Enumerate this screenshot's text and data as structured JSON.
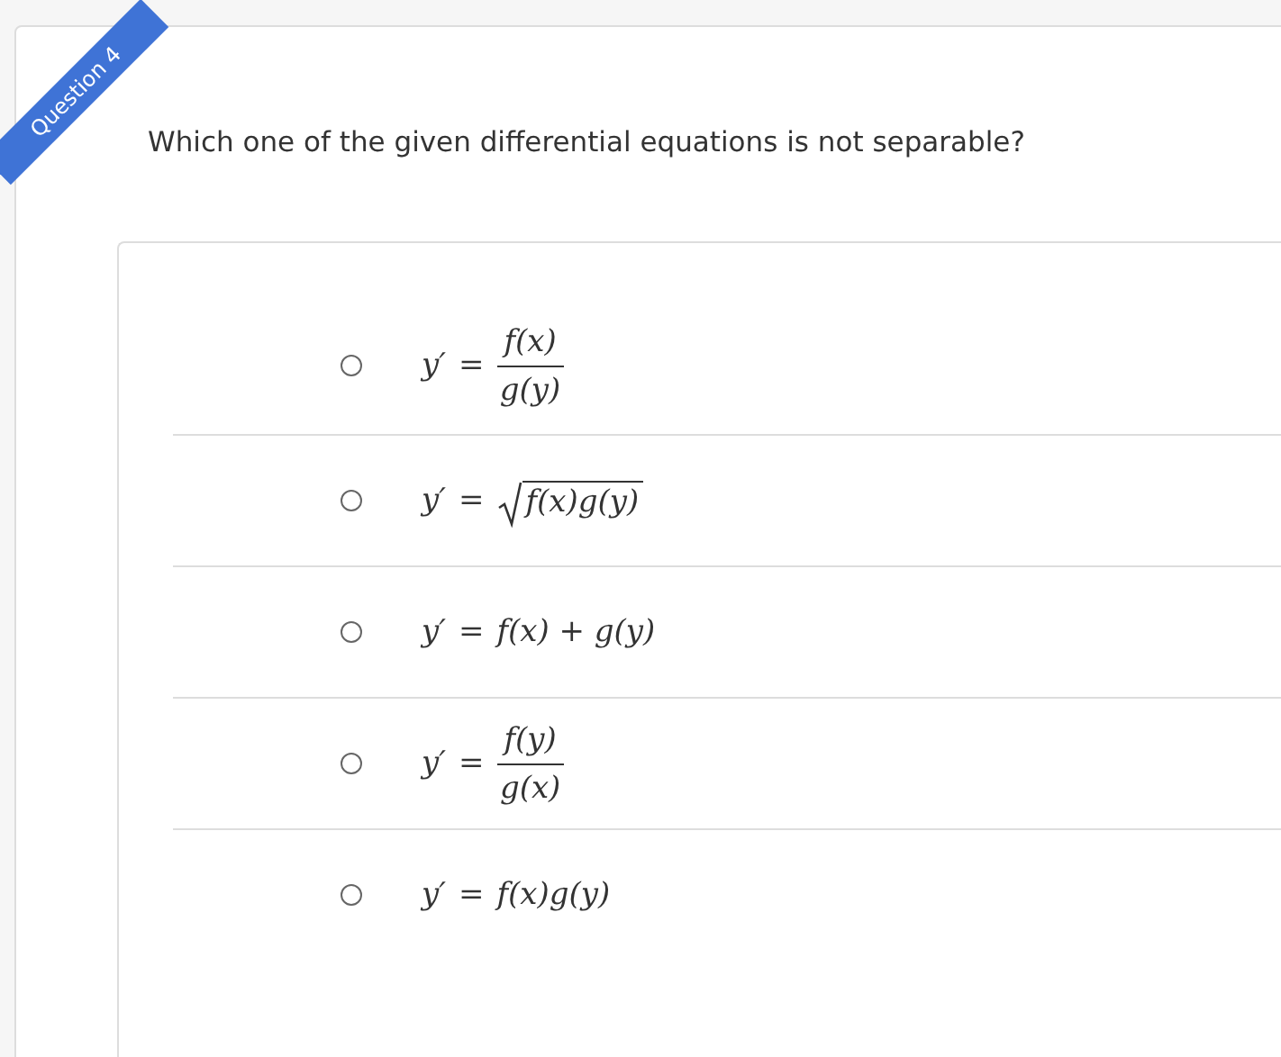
{
  "question_label": "Question 4",
  "prompt": "Which one of the given differential equations is not separable?",
  "options": [
    {
      "kind": "fraction",
      "selected": false,
      "lhs": "y′",
      "relation": "=",
      "numerator": "f(x)",
      "denominator": "g(y)"
    },
    {
      "kind": "sqrt",
      "selected": false,
      "lhs": "y′",
      "relation": "=",
      "radicand": "f(x)g(y)"
    },
    {
      "kind": "plain",
      "selected": false,
      "lhs": "y′",
      "relation": "=",
      "rhs": "f(x) + g(y)"
    },
    {
      "kind": "fraction",
      "selected": false,
      "lhs": "y′",
      "relation": "=",
      "numerator": "f(y)",
      "denominator": "g(x)"
    },
    {
      "kind": "plain",
      "selected": false,
      "lhs": "y′",
      "relation": "=",
      "rhs": "f(x)g(y)"
    }
  ]
}
